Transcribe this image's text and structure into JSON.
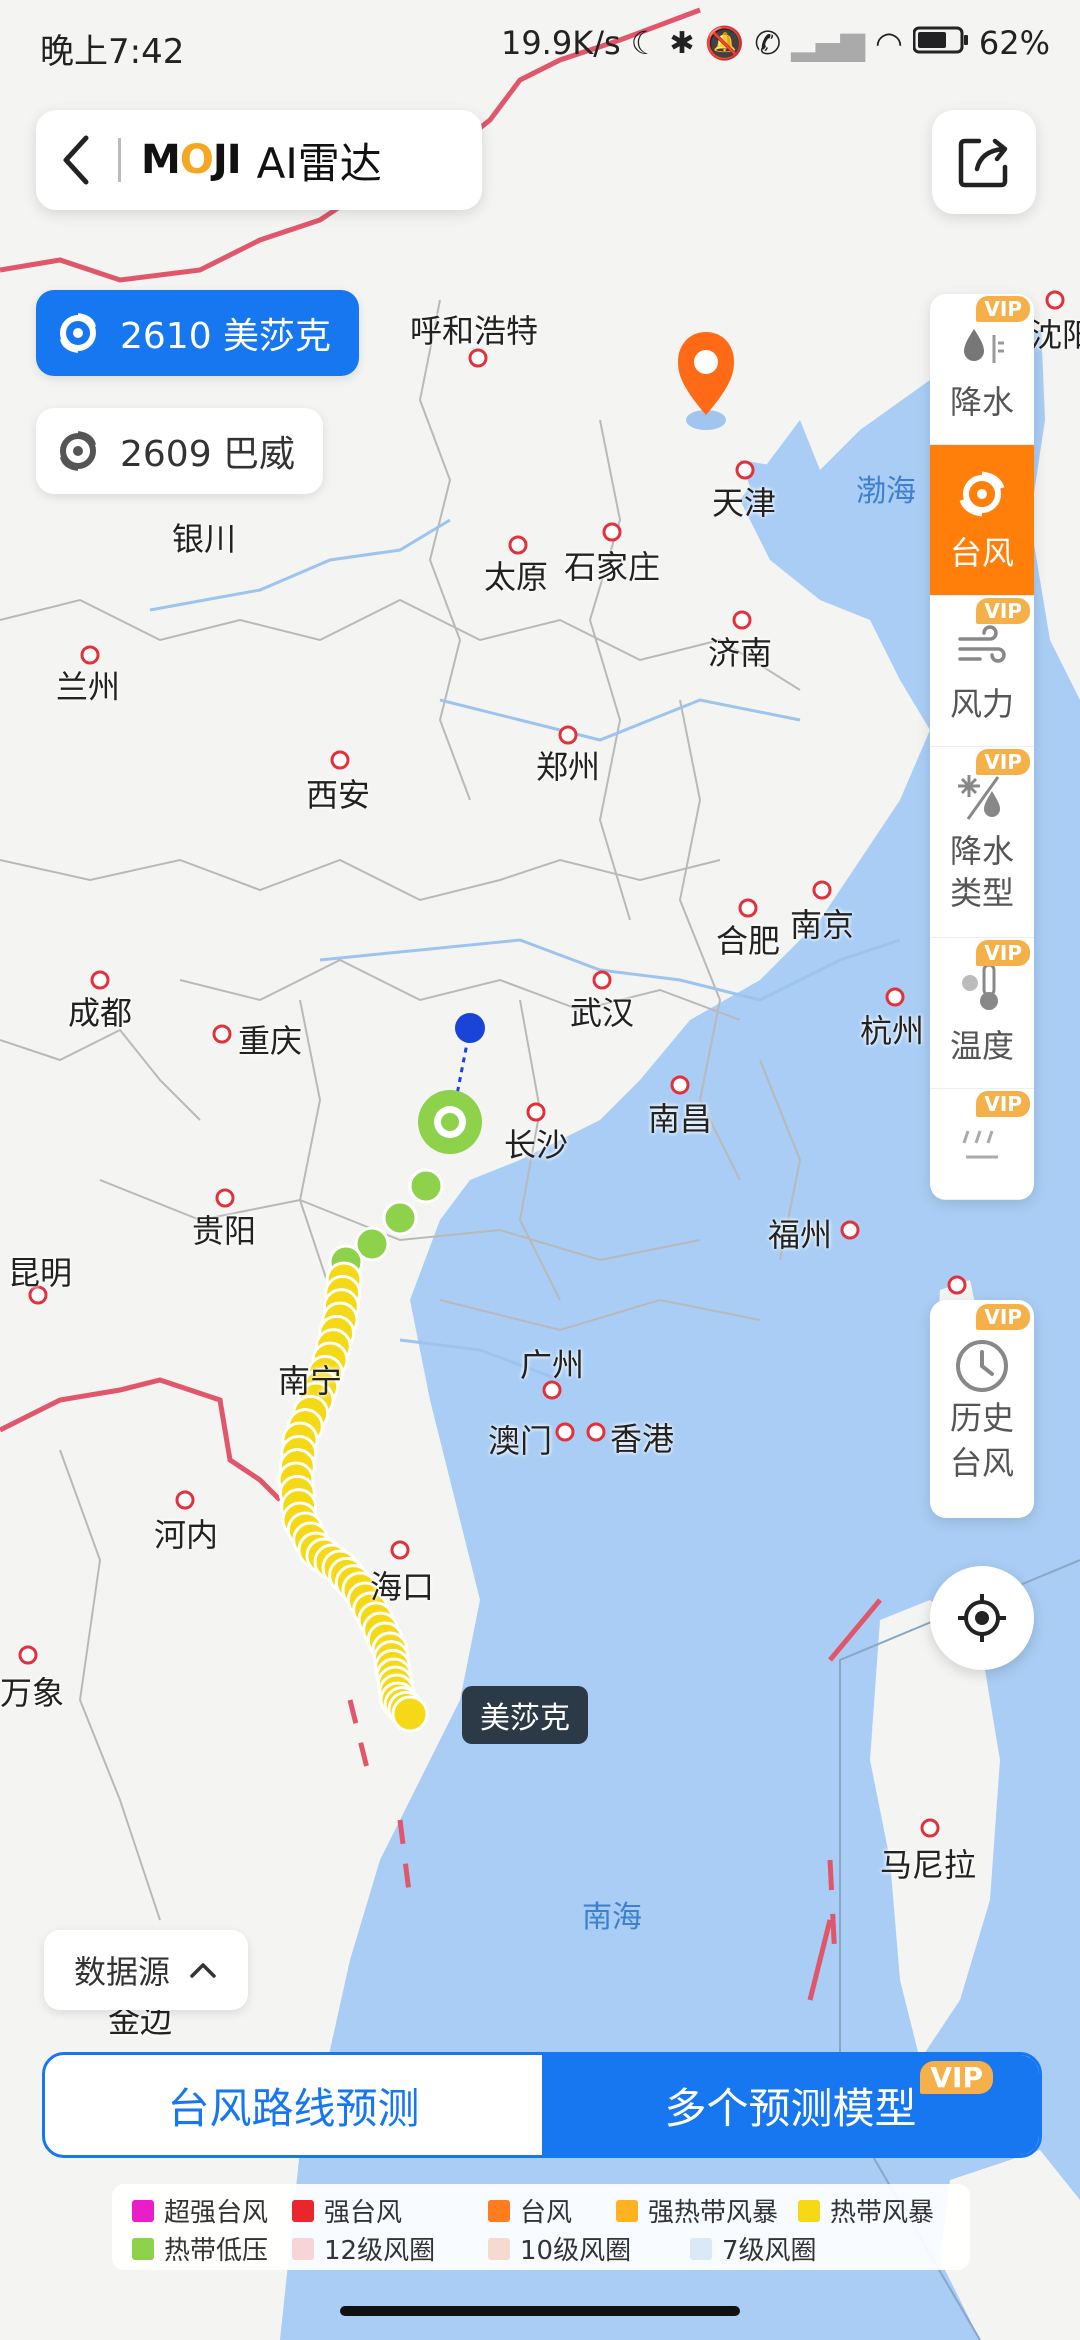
{
  "status_bar": {
    "time": "晚上7:42",
    "net_speed": "19.9K/s",
    "battery": "62%"
  },
  "header": {
    "brand": "MOJI",
    "brand_suffix": "AI雷达"
  },
  "typhoons": [
    {
      "label": "2610 美莎克",
      "active": true
    },
    {
      "label": "2609 巴威",
      "active": false
    }
  ],
  "layers": [
    {
      "label": "降水",
      "vip": "VIP",
      "icon": "raindrop-icon",
      "active": false
    },
    {
      "label": "台风",
      "vip": "",
      "icon": "typhoon-icon",
      "active": true
    },
    {
      "label": "风力",
      "vip": "VIP",
      "icon": "wind-icon",
      "active": false
    },
    {
      "label": "降水\n类型",
      "vip": "VIP",
      "icon": "precip-type-icon",
      "active": false
    },
    {
      "label": "温度",
      "vip": "VIP",
      "icon": "thermometer-icon",
      "active": false
    },
    {
      "label": "",
      "vip": "VIP",
      "icon": "rain-lines-icon",
      "active": false
    }
  ],
  "history": {
    "label_line1": "历史",
    "label_line2": "台风",
    "vip": "VIP"
  },
  "map": {
    "cities": [
      "呼和浩特",
      "天津",
      "银川",
      "太原",
      "石家庄",
      "兰州",
      "济南",
      "西安",
      "郑州",
      "合肥",
      "南京",
      "成都",
      "重庆",
      "武汉",
      "杭州",
      "长沙",
      "南昌",
      "贵阳",
      "福州",
      "昆明",
      "广州",
      "南宁",
      "澳门",
      "香港",
      "河内",
      "海口",
      "万象",
      "马尼拉",
      "沈阳",
      "金边"
    ],
    "seas": [
      "渤海",
      "南海"
    ],
    "callout": "美莎克"
  },
  "data_source": {
    "label": "数据源"
  },
  "bottom_tabs": {
    "route_forecast": "台风路线预测",
    "multi_model": "多个预测模型",
    "vip": "VIP"
  },
  "legend": {
    "items": [
      {
        "label": "超强台风",
        "color": "#e91ec9"
      },
      {
        "label": "强台风",
        "color": "#e8262b"
      },
      {
        "label": "台风",
        "color": "#ff7d1f"
      },
      {
        "label": "强热带风暴",
        "color": "#ffb21f"
      },
      {
        "label": "热带风暴",
        "color": "#f5d916"
      },
      {
        "label": "热带低压",
        "color": "#8ed14a"
      },
      {
        "label": "12级风圈",
        "color": "#f7d4d8"
      },
      {
        "label": "10级风圈",
        "color": "#f3dccf"
      },
      {
        "label": "7级风圈",
        "color": "#dbe9f7"
      }
    ]
  },
  "colors": {
    "accent": "#1677f0",
    "active_layer": "#ff7f0a",
    "vip": "#f5b04a",
    "sea": "#a9cdf4"
  }
}
